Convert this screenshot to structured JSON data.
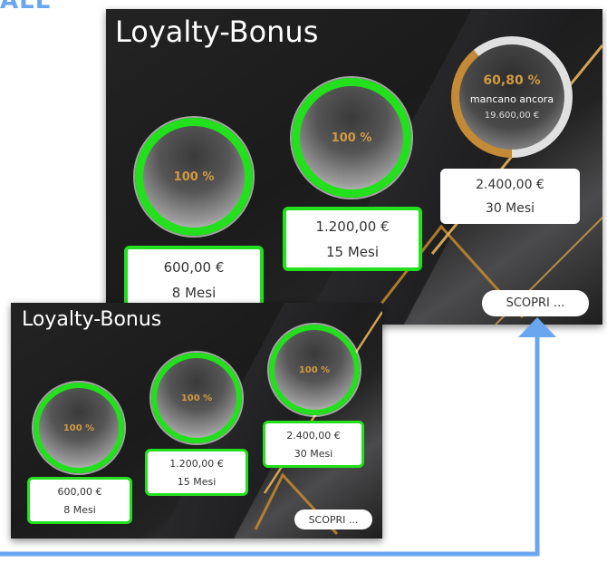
{
  "header": {
    "corner_text": "ALL"
  },
  "main_card": {
    "title": "Loyalty-Bonus",
    "tiers": [
      {
        "percent": "100 %",
        "amount": "600,00 €",
        "duration": "8 Mesi"
      },
      {
        "percent": "100 %",
        "amount": "1.200,00 €",
        "duration": "15 Mesi"
      },
      {
        "percent": "60,80 %",
        "remaining_label": "mancano ancora",
        "remaining_amount": "19.600,00 €",
        "amount": "2.400,00 €",
        "duration": "30 Mesi",
        "progress_fraction": 0.608
      }
    ],
    "discover_button": "SCOPRI ..."
  },
  "secondary_card": {
    "title": "Loyalty-Bonus",
    "tiers": [
      {
        "percent": "100 %",
        "amount": "600,00 €",
        "duration": "8 Mesi"
      },
      {
        "percent": "100 %",
        "amount": "1.200,00 €",
        "duration": "15 Mesi"
      },
      {
        "percent": "100 %",
        "amount": "2.400,00 €",
        "duration": "30 Mesi"
      }
    ],
    "discover_button": "SCOPRI ..."
  },
  "colors": {
    "highlight": "#22e01c",
    "arrow": "#6aa6f0",
    "gold": "#d39a3f"
  }
}
